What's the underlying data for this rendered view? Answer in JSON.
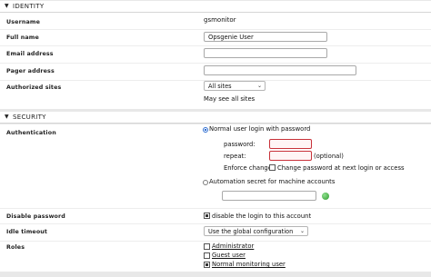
{
  "identity": {
    "title": "IDENTITY",
    "username_label": "Username",
    "username_value": "gsmonitor",
    "fullname_label": "Full name",
    "fullname_value": "Opsgenie User",
    "email_label": "Email address",
    "email_value": "",
    "pager_label": "Pager address",
    "pager_value": "",
    "authsites_label": "Authorized sites",
    "authsites_value": "All sites",
    "authsites_note": "May see all sites"
  },
  "security": {
    "title": "SECURITY",
    "auth_label": "Authentication",
    "normal_login_label": "Normal user login with password",
    "password_label": "password:",
    "repeat_label": "repeat:",
    "optional_label": "(optional)",
    "enforce_label": "Enforce change:",
    "change_pw_label": "Change password at next login or access",
    "automation_label": "Automation secret for machine accounts",
    "disable_label": "Disable password",
    "disable_text": "disable the login to this account",
    "idle_label": "Idle timeout",
    "idle_value": "Use the global configuration",
    "roles_label": "Roles",
    "roles": [
      "Administrator",
      "Guest user",
      "Normal monitoring user"
    ]
  },
  "icons": {
    "collapse": "triangle-down-icon",
    "dice": "dice-icon"
  }
}
